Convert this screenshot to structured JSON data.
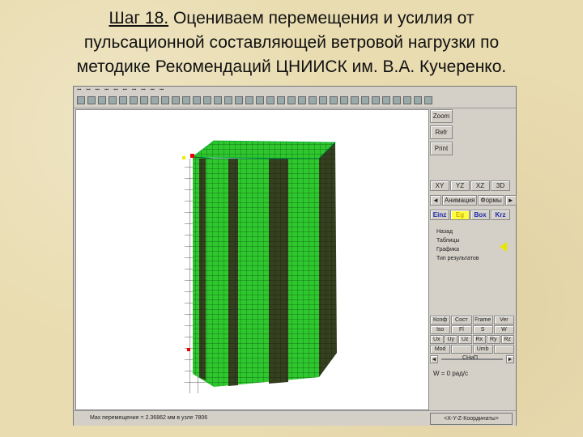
{
  "slide": {
    "step_label": "Шаг 18.",
    "title_line1_rest": " Оцениваем перемещения и усилия от",
    "title_line2": "пульсационной составляющей ветровой нагрузки по",
    "title_line3": "методике Рекомендаций ЦНИИСК им. В.А. Кучеренко."
  },
  "panel": {
    "zoom": "Zoom",
    "refr": "Refr",
    "print": "Print",
    "views": [
      "XY",
      "YZ",
      "XZ",
      "3D"
    ],
    "anim_tab": "Анимация",
    "forms_tab": "Формы",
    "result_tabs": [
      "Einz",
      "Eg",
      "Box",
      "Krz"
    ],
    "options": [
      "Назад",
      "Таблицы",
      "Графика",
      "Тип результатов"
    ],
    "row1": [
      "Коэф",
      "Сост",
      "Frame",
      "Ver"
    ],
    "row2": [
      "Iso",
      "Fl",
      "S",
      "W"
    ],
    "row3": [
      "Ux",
      "Uy",
      "Uz",
      "Rx",
      "Ry",
      "Rz"
    ],
    "row4": [
      "Mod",
      "",
      "Umb",
      ""
    ],
    "slider_value": "СНиП",
    "w_line": "W = 0 рад/с"
  },
  "status": {
    "max_displacement": "Max перемещение = 2.36862 мм в узле 7806",
    "coords_button": "<X-Y-Z-Координаты>"
  },
  "colors": {
    "mesh_green": "#2ec82e",
    "mesh_dark": "#2f3a20",
    "selected_tab": "#ffff40"
  }
}
